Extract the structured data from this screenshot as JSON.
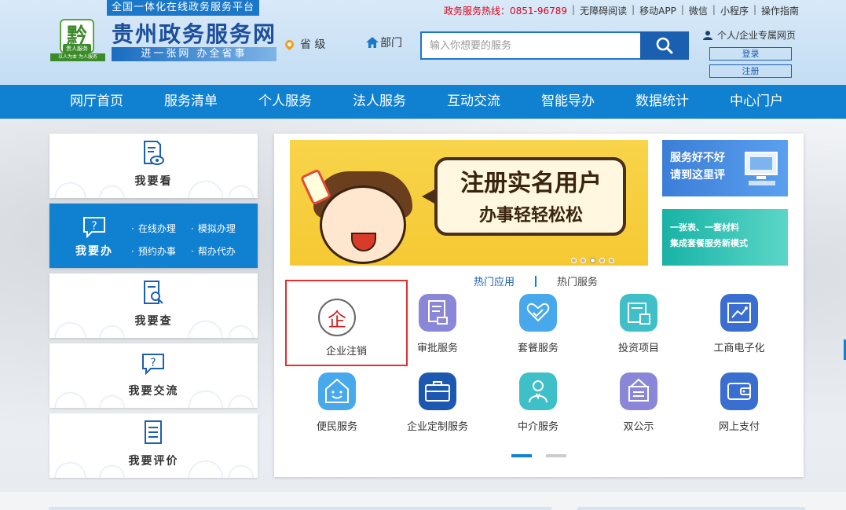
{
  "header": {
    "tagline": "全国一体化在线政务服务平台",
    "logo_glyph": "黔",
    "logo_badge": "贵人服务",
    "logo_sub": "以人为本 为人服务",
    "site_title": "贵州政务服务网",
    "slogan": "进一张网 办全省事",
    "location_label": "省 级",
    "dept_label": "部门",
    "search_placeholder": "输入你想要的服务",
    "hotline": "政务服务热线：0851-96789",
    "toplinks": [
      "无障碍阅读",
      "移动APP",
      "微信",
      "小程序",
      "操作指南"
    ],
    "user_label": "个人/企业专属网页",
    "login_label": "登录",
    "register_label": "注册"
  },
  "nav": {
    "items": [
      "网厅首页",
      "服务清单",
      "个人服务",
      "法人服务",
      "互动交流",
      "智能导办",
      "数据统计",
      "中心门户"
    ]
  },
  "left_cards": {
    "see": "我要看",
    "do": "我要办",
    "do_links": [
      "在线办理",
      "模拟办理",
      "预约办事",
      "帮办代办"
    ],
    "check": "我要查",
    "talk": "我要交流",
    "rate": "我要评价"
  },
  "banner": {
    "line1": "注册实名用户",
    "line2": "办事轻轻松松",
    "dots_total": 5,
    "dots_active": 3
  },
  "side_banners": {
    "one_line1": "服务好不好",
    "one_line2": "请到这里评",
    "two_line1": "一张表、一套材料",
    "two_line2": "集成套餐服务新模式"
  },
  "hot_tabs": [
    "热门应用",
    "热门服务"
  ],
  "services": [
    {
      "label": "企业注销",
      "icon": "enterprise-icon",
      "glyph": "企"
    },
    {
      "label": "审批服务",
      "icon": "document-stamp-icon"
    },
    {
      "label": "套餐服务",
      "icon": "heart-hands-icon"
    },
    {
      "label": "投资项目",
      "icon": "folder-chart-icon"
    },
    {
      "label": "工商电子化",
      "icon": "circuit-board-icon"
    },
    {
      "label": "便民服务",
      "icon": "smile-house-icon"
    },
    {
      "label": "企业定制服务",
      "icon": "briefcase-icon"
    },
    {
      "label": "中介服务",
      "icon": "person-icon"
    },
    {
      "label": "双公示",
      "icon": "notice-board-icon"
    },
    {
      "label": "网上支付",
      "icon": "wallet-icon"
    }
  ],
  "colors": {
    "primary": "#1080d0",
    "dark_blue": "#1b5fb0",
    "hotline_red": "#e0001a",
    "highlight_border": "#e03030",
    "banner_yellow": "#f5c933"
  }
}
